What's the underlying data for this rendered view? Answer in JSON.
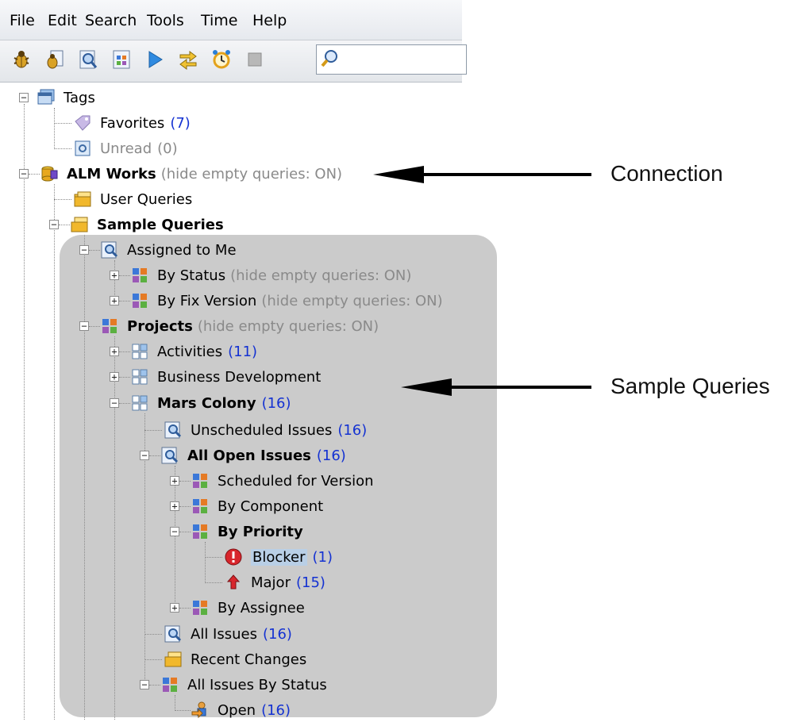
{
  "menu": [
    "File",
    "Edit",
    "Search",
    "Tools",
    "Time",
    "Help"
  ],
  "toolbar_icons": [
    "new-bug-icon",
    "bug-query-icon",
    "search-query-icon",
    "distribution-icon",
    "play-icon",
    "synchronize-icon",
    "alarm-clock-icon",
    "stop-icon"
  ],
  "search": {
    "placeholder": ""
  },
  "tree": {
    "tags": {
      "label": "Tags"
    },
    "favorites": {
      "label": "Favorites",
      "count": "(7)"
    },
    "unread": {
      "label": "Unread",
      "count": "(0)"
    },
    "alm": {
      "label": "ALM Works",
      "note": "(hide empty queries: ON)"
    },
    "user_queries": {
      "label": "User Queries"
    },
    "sample_queries": {
      "label": "Sample Queries"
    },
    "assigned": {
      "label": "Assigned to Me"
    },
    "by_status": {
      "label": "By Status",
      "note": "(hide empty queries: ON)"
    },
    "by_fix_version": {
      "label": "By Fix Version",
      "note": "(hide empty queries: ON)"
    },
    "projects": {
      "label": "Projects",
      "note": "(hide empty queries: ON)"
    },
    "activities": {
      "label": "Activities",
      "count": "(11)"
    },
    "business": {
      "label": "Business Development"
    },
    "mars": {
      "label": "Mars Colony",
      "count": "(16)"
    },
    "unscheduled": {
      "label": "Unscheduled Issues",
      "count": "(16)"
    },
    "all_open": {
      "label": "All Open Issues",
      "count": "(16)"
    },
    "scheduled": {
      "label": "Scheduled for Version"
    },
    "by_component": {
      "label": "By Component"
    },
    "by_priority": {
      "label": "By Priority"
    },
    "blocker": {
      "label": "Blocker",
      "count": "(1)"
    },
    "major": {
      "label": "Major",
      "count": "(15)"
    },
    "by_assignee": {
      "label": "By Assignee"
    },
    "all_issues": {
      "label": "All Issues",
      "count": "(16)"
    },
    "recent": {
      "label": "Recent Changes"
    },
    "by_status_all": {
      "label": "All Issues By Status"
    },
    "open": {
      "label": "Open",
      "count": "(16)"
    }
  },
  "annotations": {
    "connection": "Connection",
    "sample_queries": "Sample Queries"
  },
  "colors": {
    "count": "#1432d2",
    "note": "#8a8a8a",
    "highlight": "#cbcbcb",
    "selection": "#b9cfe6"
  }
}
